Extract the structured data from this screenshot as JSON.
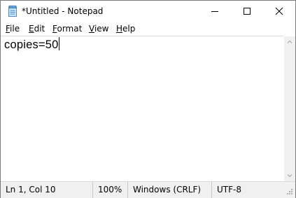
{
  "window": {
    "title": "*Untitled - Notepad",
    "icons": {
      "app": "notepad-icon",
      "minimize": "minimize-icon",
      "maximize": "maximize-icon",
      "close": "close-icon"
    }
  },
  "menu": {
    "items": [
      {
        "accel": "F",
        "rest": "ile"
      },
      {
        "accel": "E",
        "rest": "dit"
      },
      {
        "accel": "F",
        "rest": "ormat",
        "prefix": ""
      },
      {
        "accel": "V",
        "rest": "iew"
      },
      {
        "accel": "H",
        "rest": "elp"
      }
    ]
  },
  "editor": {
    "content": "copies=50"
  },
  "statusbar": {
    "position": "Ln 1, Col 10",
    "zoom": "100%",
    "line_ending": "Windows (CRLF)",
    "encoding": "UTF-8"
  },
  "colors": {
    "chrome": "#f0f0f0",
    "border": "#dadada",
    "text": "#000000"
  }
}
